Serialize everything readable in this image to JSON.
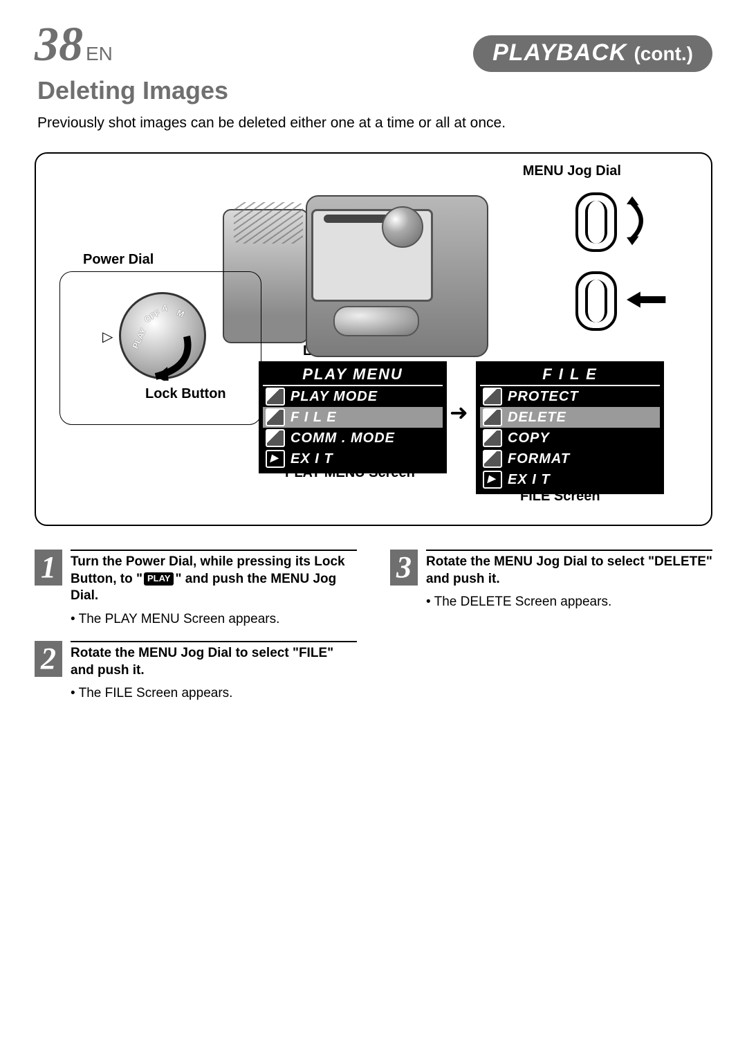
{
  "header": {
    "page_number": "38",
    "lang": "EN",
    "section_main": "PLAYBACK",
    "section_cont": "(cont.)"
  },
  "title": "Deleting Images",
  "intro": "Previously shot images can be deleted either one at a time or all at once.",
  "labels": {
    "menu_jog_dial": "MENU Jog Dial",
    "power_dial": "Power Dial",
    "lock_button": "Lock Button",
    "lcd_monitor": "LCD monitor",
    "play_menu_screen": "PLAY MENU Screen",
    "file_screen": "FILE Screen"
  },
  "power_dial": {
    "marker": "▷",
    "opt_play": "PLAY",
    "opt_off": "OFF",
    "opt_a": "A",
    "opt_m": "M"
  },
  "play_menu": {
    "title": "PLAY  MENU",
    "items": [
      "PLAY  MODE",
      "F I L E",
      "COMM .  MODE",
      "EX I T"
    ]
  },
  "file_menu": {
    "title": "F I L E",
    "items": [
      "PROTECT",
      "DELETE",
      "COPY",
      "FORMAT",
      "EX I T"
    ]
  },
  "arrow": "➜",
  "steps": [
    {
      "num": "1",
      "title_pre": "Turn the Power Dial, while pressing its Lock Button, to \"",
      "badge": "PLAY",
      "title_post": "\" and push the MENU Jog Dial.",
      "bullet": "The PLAY MENU Screen appears."
    },
    {
      "num": "2",
      "title": "Rotate the MENU Jog Dial to select \"FILE\" and push it.",
      "bullet": "The FILE Screen appears."
    },
    {
      "num": "3",
      "title": "Rotate the MENU Jog Dial to select \"DELETE\" and push it.",
      "bullet": "The DELETE Screen appears."
    }
  ]
}
